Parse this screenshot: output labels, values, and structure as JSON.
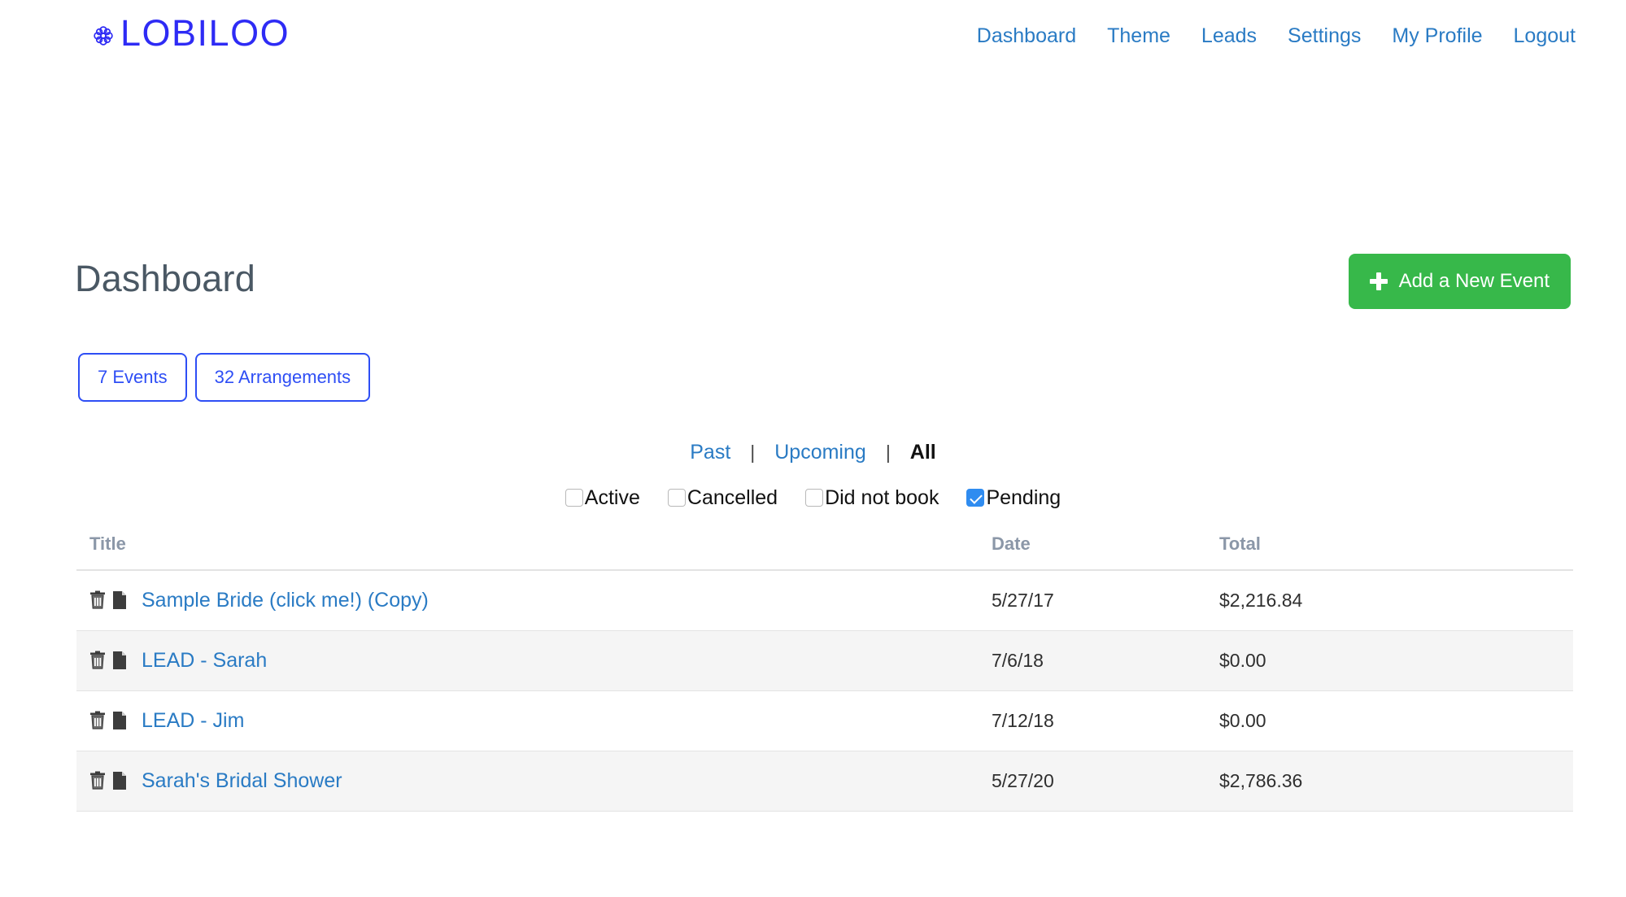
{
  "header": {
    "brand_name": "LOBILOO",
    "brand_icon": "flower-icon",
    "nav": [
      {
        "label": "Dashboard"
      },
      {
        "label": "Theme"
      },
      {
        "label": "Leads"
      },
      {
        "label": "Settings"
      },
      {
        "label": "My Profile"
      },
      {
        "label": "Logout"
      }
    ]
  },
  "main": {
    "page_title": "Dashboard",
    "add_event_button": "Add a New Event",
    "add_event_icon": "plus-icon",
    "stats": [
      {
        "label": "7 Events"
      },
      {
        "label": "32 Arrangements"
      }
    ],
    "time_filters": [
      {
        "label": "Past",
        "active": false
      },
      {
        "label": "Upcoming",
        "active": false
      },
      {
        "label": "All",
        "active": true
      }
    ],
    "filter_separator": "|",
    "status_filters": [
      {
        "label": "Active",
        "checked": false
      },
      {
        "label": "Cancelled",
        "checked": false
      },
      {
        "label": "Did not book",
        "checked": false
      },
      {
        "label": "Pending",
        "checked": true
      }
    ],
    "table": {
      "columns": {
        "title": "Title",
        "date": "Date",
        "total": "Total"
      },
      "row_icons": {
        "delete": "trash-icon",
        "copy": "document-copy-icon"
      },
      "rows": [
        {
          "title": "Sample Bride (click me!) (Copy)",
          "date": "5/27/17",
          "total": "$2,216.84"
        },
        {
          "title": "LEAD - Sarah",
          "date": "7/6/18",
          "total": "$0.00"
        },
        {
          "title": "LEAD - Jim",
          "date": "7/12/18",
          "total": "$0.00"
        },
        {
          "title": "Sarah's Bridal Shower",
          "date": "5/27/20",
          "total": "$2,786.36"
        }
      ]
    }
  },
  "colors": {
    "brand_blue": "#2e2bf5",
    "link_blue": "#2a7bc4",
    "accent_green": "#37b84a",
    "checkbox_blue": "#2f8cf0",
    "heading_gray": "#4a5864",
    "table_header_gray": "#8b97a8",
    "stripe_gray": "#f5f5f5"
  }
}
